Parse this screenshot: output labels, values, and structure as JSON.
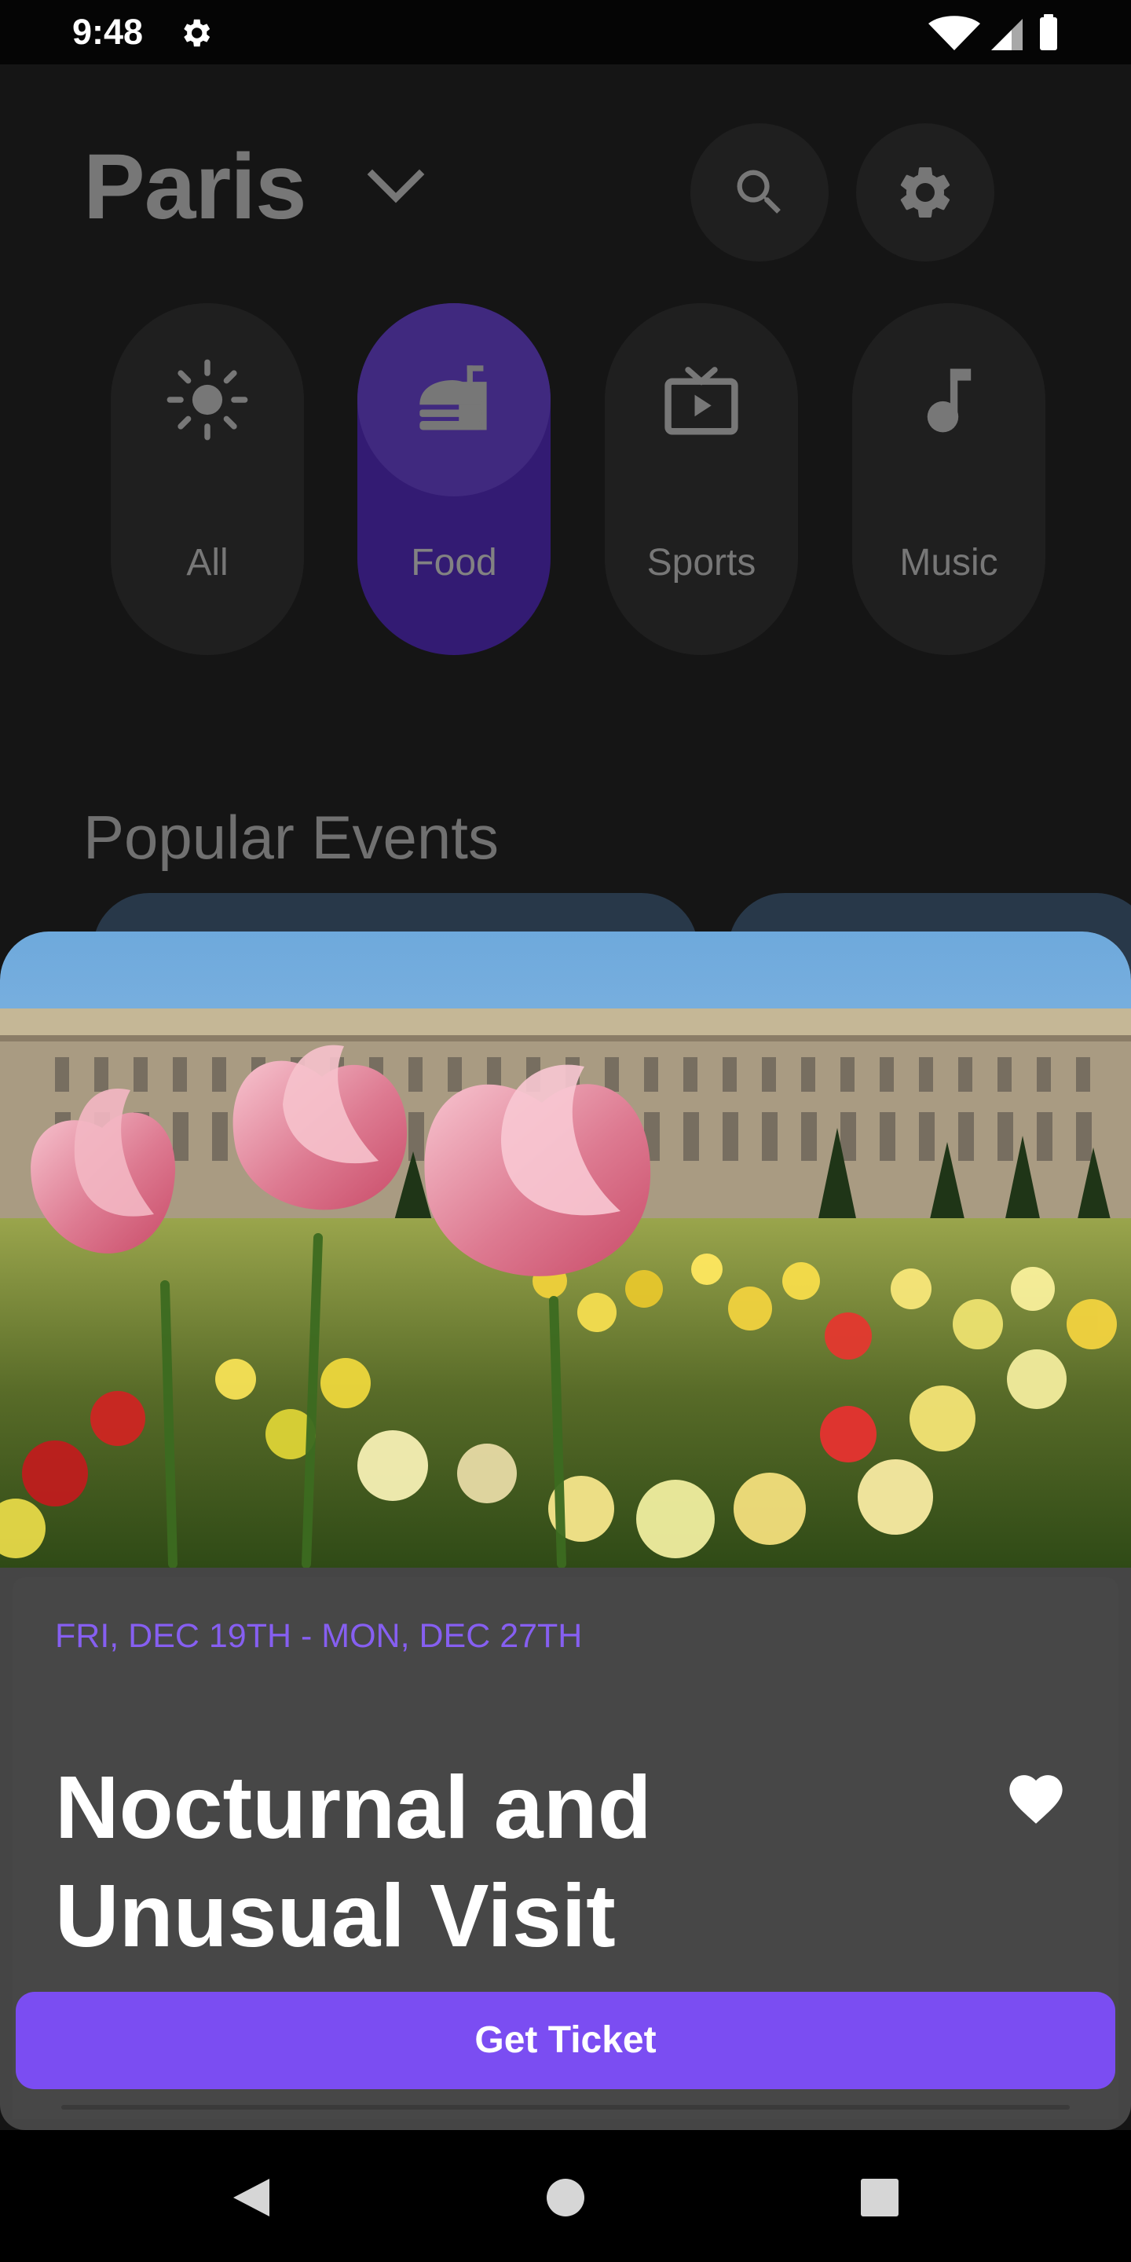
{
  "status_bar": {
    "time": "9:48",
    "icons": [
      "settings-icon",
      "wifi-icon",
      "cellular-signal-icon",
      "battery-icon"
    ]
  },
  "header": {
    "city": "Paris",
    "dropdown_icon": "chevron-down-icon",
    "actions": [
      {
        "name": "search",
        "icon": "search-icon"
      },
      {
        "name": "settings",
        "icon": "settings-icon"
      }
    ]
  },
  "categories": [
    {
      "label": "All",
      "icon": "sun-icon",
      "selected": false
    },
    {
      "label": "Food",
      "icon": "fast-food-icon",
      "selected": true
    },
    {
      "label": "Sports",
      "icon": "tv-icon",
      "selected": false
    },
    {
      "label": "Music",
      "icon": "music-note-icon",
      "selected": false
    }
  ],
  "section": {
    "title": "Popular Events"
  },
  "featured_event": {
    "date": "FRI, DEC 19TH - MON, DEC 27TH",
    "title_line_1": "Nocturnal and",
    "title_line_2": "Unusual Visit",
    "favorite_icon": "heart-icon",
    "favorited": true,
    "button": "Get Ticket"
  },
  "navigation": {
    "icons": [
      "back-icon",
      "home-icon",
      "recents-icon"
    ]
  },
  "colors": {
    "background": "#151515",
    "surface": "#1f1f1f",
    "selected_chip": "#331b73",
    "selected_chip_icon_bg": "#40297f",
    "accent": "#7b4df2",
    "date_text": "#865ff1",
    "muted_text": "#777777",
    "card": "#474747"
  }
}
